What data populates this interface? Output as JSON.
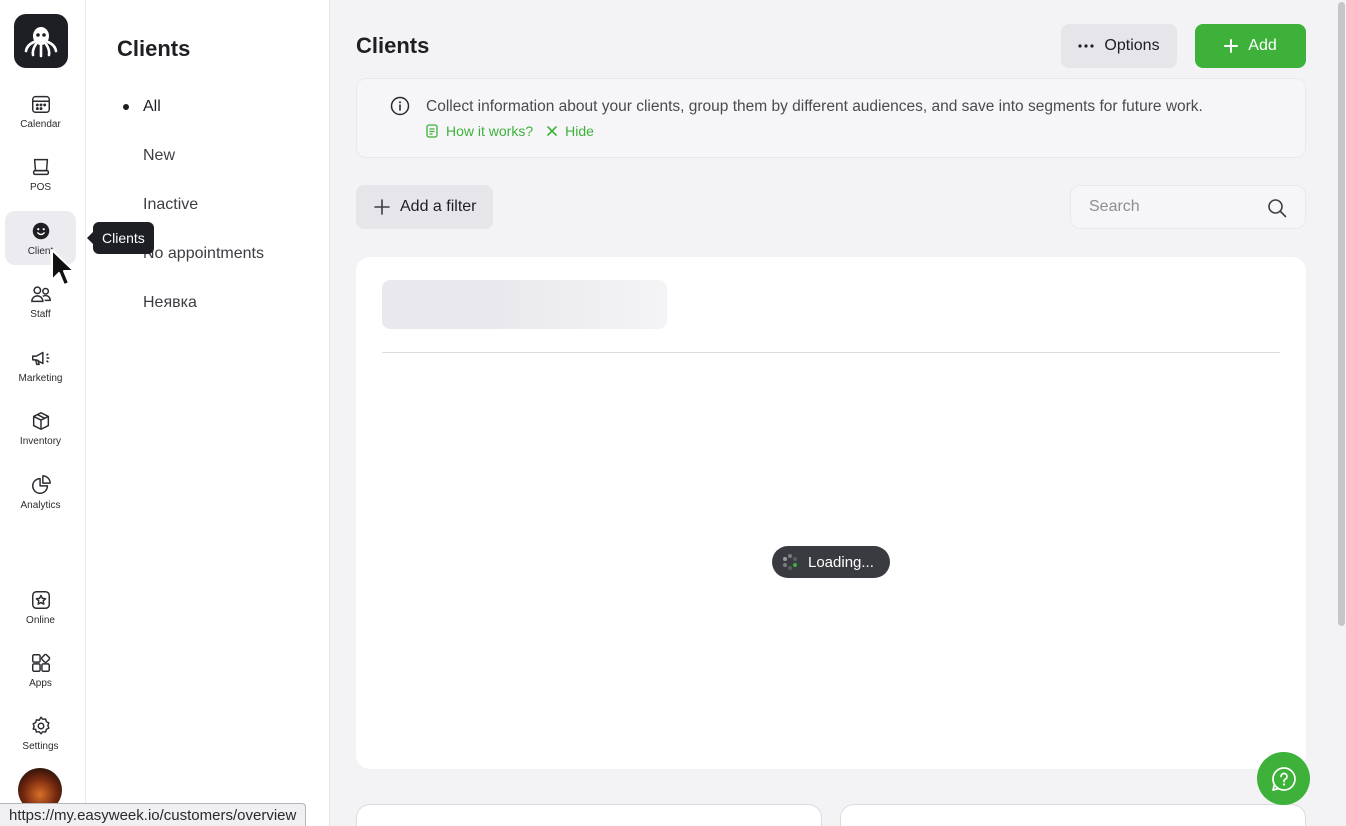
{
  "rail": {
    "items": [
      {
        "label": "Calendar",
        "icon": "calendar-icon"
      },
      {
        "label": "POS",
        "icon": "pos-icon"
      },
      {
        "label": "Clients",
        "icon": "smiley-icon"
      },
      {
        "label": "Staff",
        "icon": "staff-icon"
      },
      {
        "label": "Marketing",
        "icon": "megaphone-icon"
      },
      {
        "label": "Inventory",
        "icon": "box-icon"
      },
      {
        "label": "Analytics",
        "icon": "pie-chart-icon"
      },
      {
        "label": "Online",
        "icon": "star-badge-icon"
      },
      {
        "label": "Apps",
        "icon": "apps-icon"
      },
      {
        "label": "Settings",
        "icon": "gear-icon"
      }
    ],
    "active_label_visible": "Client"
  },
  "tooltip": {
    "text": "Clients"
  },
  "subnav": {
    "title": "Clients",
    "items": [
      {
        "label": "All"
      },
      {
        "label": "New"
      },
      {
        "label": "Inactive"
      },
      {
        "label": "No appointments"
      },
      {
        "label": "Неявка"
      }
    ]
  },
  "main": {
    "title": "Clients",
    "options_label": "Options",
    "add_label": "Add",
    "info": {
      "text": "Collect information about your clients, group them by different audiences, and save into segments for future work.",
      "how_label": "How it works?",
      "hide_label": "Hide"
    },
    "filter_label": "Add a filter",
    "search": {
      "placeholder": "Search",
      "value": ""
    },
    "loading_text": "Loading..."
  },
  "status_bar": {
    "url": "https://my.easyweek.io/customers/overview"
  },
  "colors": {
    "accent": "#3db13a",
    "dark": "#1e1f24"
  }
}
